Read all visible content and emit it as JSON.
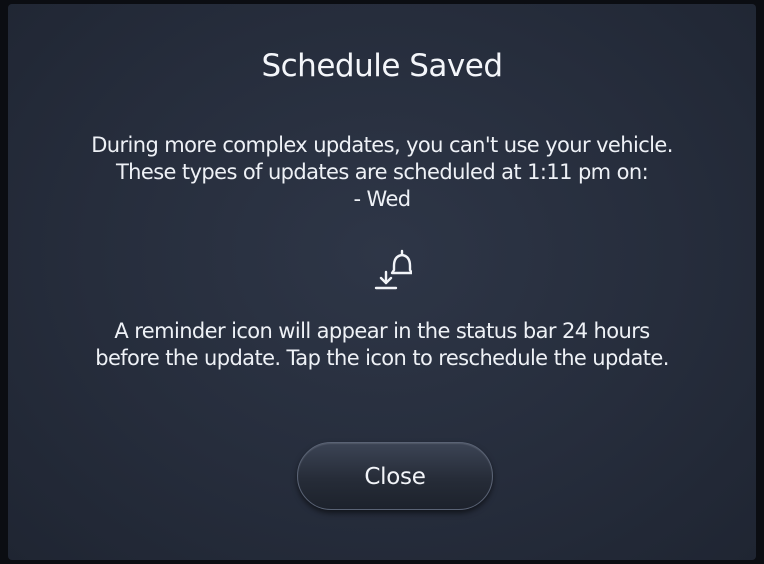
{
  "dialog": {
    "title": "Schedule Saved",
    "body_lines": [
      "During more complex updates, you can't use your vehicle.",
      "These types of updates are scheduled at 1:11 pm on:",
      "- Wed"
    ],
    "reminder_lines": [
      "A reminder icon will appear in the status bar 24 hours",
      "before the update. Tap the icon to reschedule the update."
    ],
    "icon": "download-bell-icon",
    "close_label": "Close"
  },
  "colors": {
    "background": "#262d3c",
    "text": "#f2f4f8",
    "button": "#2b3140",
    "button_border": "#5a6375"
  }
}
